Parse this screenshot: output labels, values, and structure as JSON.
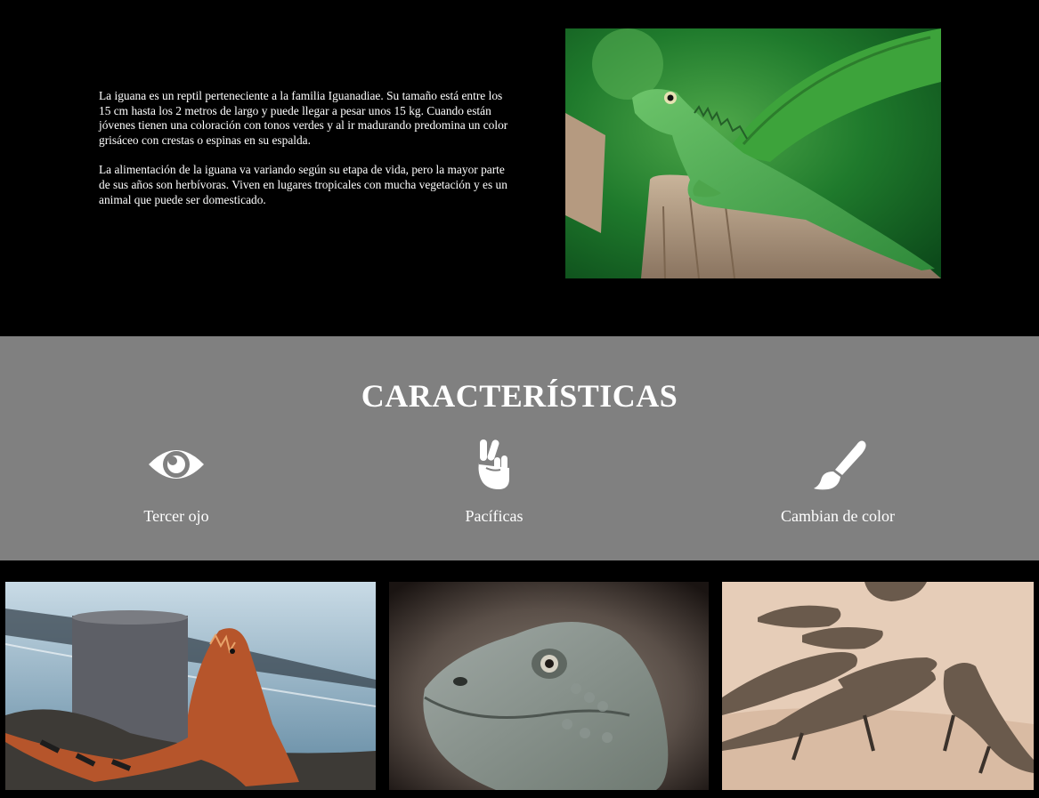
{
  "intro": {
    "paragraphs": [
      "La iguana es un reptil perteneciente a la familia Iguanadiae. Su tamaño está entre los 15 cm hasta los 2 metros de largo y puede llegar a pesar unos 15 kg. Cuando están jóvenes tienen una coloración con tonos verdes y al ir madurando predomina un color grisáceo con crestas o espinas en su espalda.",
      "La alimentación de la iguana va variando según su etapa de vida, pero la mayor parte de sus años son herbívoras. Viven en lugares tropicales con mucha vegetación y es un animal que puede ser domesticado."
    ],
    "hero_image": "green-iguana-on-stump-photo"
  },
  "features": {
    "title": "CARACTERÍSTICAS",
    "items": [
      {
        "icon": "eye-icon",
        "label": "Tercer ojo"
      },
      {
        "icon": "peace-hand-icon",
        "label": "Pacíficas"
      },
      {
        "icon": "paint-brush-icon",
        "label": "Cambian de color"
      }
    ]
  },
  "gallery": [
    "orange-iguana-by-water-photo",
    "iguana-head-closeup-photo",
    "group-of-iguanas-on-sand-photo"
  ],
  "colors": {
    "page_background": "#000000",
    "features_background": "#808080",
    "text": "#ffffff"
  }
}
